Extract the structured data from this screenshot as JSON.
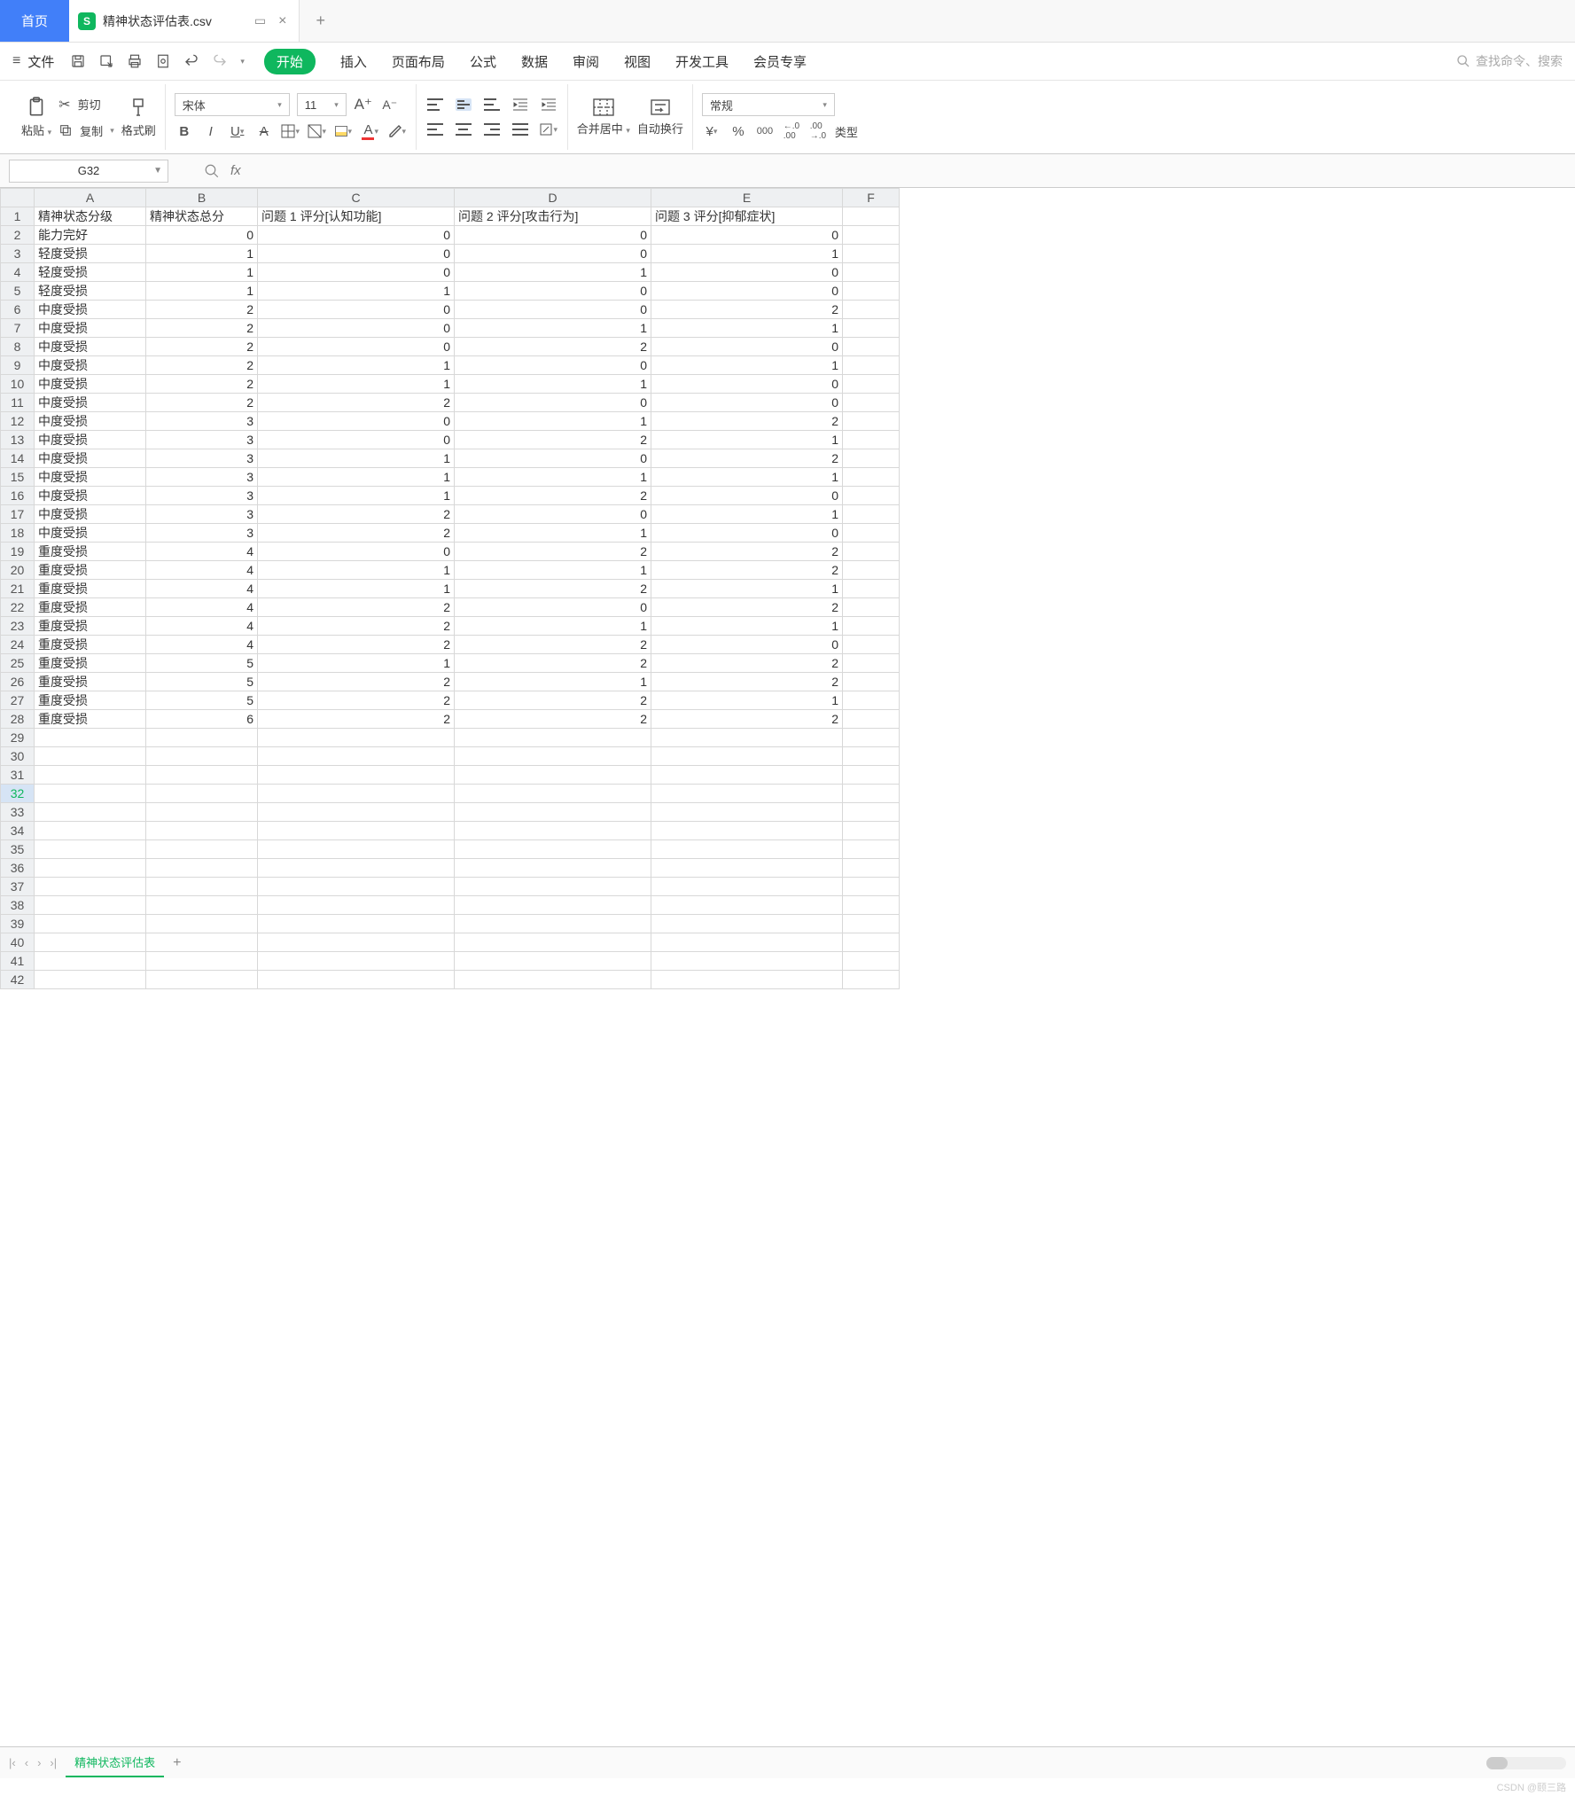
{
  "titlebar": {
    "home": "首页",
    "doc_name": "精神状态评估表.csv",
    "logo_letter": "S"
  },
  "menu": {
    "file": "文件",
    "tabs": [
      "开始",
      "插入",
      "页面布局",
      "公式",
      "数据",
      "审阅",
      "视图",
      "开发工具",
      "会员专享"
    ],
    "search_placeholder": "查找命令、搜索"
  },
  "ribbon": {
    "cut": "剪切",
    "paste": "粘贴",
    "copy": "复制",
    "format_painter": "格式刷",
    "font_name": "宋体",
    "font_size": "11",
    "merge": "合并居中",
    "wrap": "自动换行",
    "number_format": "常规",
    "type_label": "类型"
  },
  "namebox": {
    "cell": "G32",
    "fx": "fx"
  },
  "grid": {
    "columns": [
      "A",
      "B",
      "C",
      "D",
      "E",
      "F"
    ],
    "headers": [
      "精神状态分级",
      "精神状态总分",
      "问题 1 评分[认知功能]",
      "问题 2 评分[攻击行为]",
      "问题 3 评分[抑郁症状]"
    ],
    "rows": [
      [
        "能力完好",
        0,
        0,
        0,
        0
      ],
      [
        "轻度受损",
        1,
        0,
        0,
        1
      ],
      [
        "轻度受损",
        1,
        0,
        1,
        0
      ],
      [
        "轻度受损",
        1,
        1,
        0,
        0
      ],
      [
        "中度受损",
        2,
        0,
        0,
        2
      ],
      [
        "中度受损",
        2,
        0,
        1,
        1
      ],
      [
        "中度受损",
        2,
        0,
        2,
        0
      ],
      [
        "中度受损",
        2,
        1,
        0,
        1
      ],
      [
        "中度受损",
        2,
        1,
        1,
        0
      ],
      [
        "中度受损",
        2,
        2,
        0,
        0
      ],
      [
        "中度受损",
        3,
        0,
        1,
        2
      ],
      [
        "中度受损",
        3,
        0,
        2,
        1
      ],
      [
        "中度受损",
        3,
        1,
        0,
        2
      ],
      [
        "中度受损",
        3,
        1,
        1,
        1
      ],
      [
        "中度受损",
        3,
        1,
        2,
        0
      ],
      [
        "中度受损",
        3,
        2,
        0,
        1
      ],
      [
        "中度受损",
        3,
        2,
        1,
        0
      ],
      [
        "重度受损",
        4,
        0,
        2,
        2
      ],
      [
        "重度受损",
        4,
        1,
        1,
        2
      ],
      [
        "重度受损",
        4,
        1,
        2,
        1
      ],
      [
        "重度受损",
        4,
        2,
        0,
        2
      ],
      [
        "重度受损",
        4,
        2,
        1,
        1
      ],
      [
        "重度受损",
        4,
        2,
        2,
        0
      ],
      [
        "重度受损",
        5,
        1,
        2,
        2
      ],
      [
        "重度受损",
        5,
        2,
        1,
        2
      ],
      [
        "重度受损",
        5,
        2,
        2,
        1
      ],
      [
        "重度受损",
        6,
        2,
        2,
        2
      ]
    ],
    "total_rows": 42,
    "active_row": 32
  },
  "sheetbar": {
    "sheet_name": "精神状态评估表"
  },
  "watermark": "CSDN @颐三路"
}
